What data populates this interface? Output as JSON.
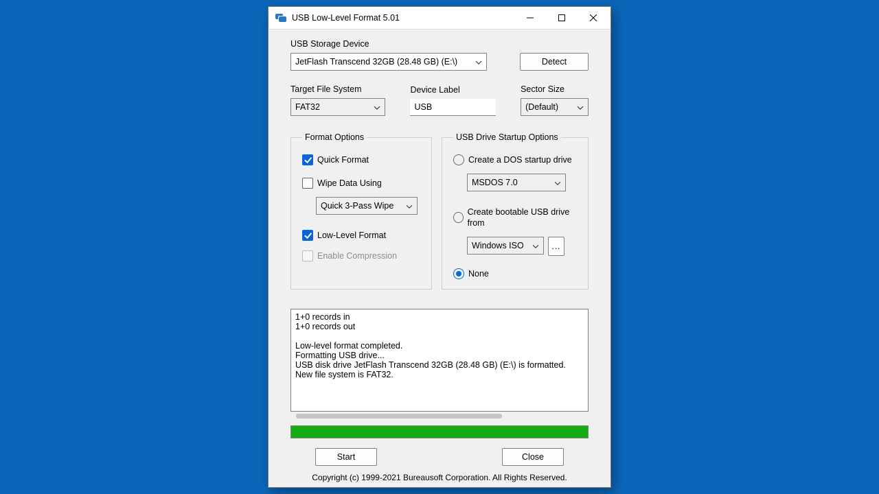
{
  "window": {
    "title": "USB Low-Level Format 5.01"
  },
  "device": {
    "label": "USB Storage Device",
    "selected": "JetFlash Transcend 32GB (28.48 GB) (E:\\)",
    "detect_button": "Detect"
  },
  "target_fs": {
    "label": "Target File System",
    "selected": "FAT32"
  },
  "dev_label": {
    "label": "Device Label",
    "value": "USB"
  },
  "sector": {
    "label": "Sector Size",
    "selected": "(Default)"
  },
  "format_opts": {
    "legend": "Format Options",
    "quick_format": "Quick Format",
    "wipe_using": "Wipe Data Using",
    "wipe_method": "Quick 3-Pass Wipe",
    "low_level": "Low-Level Format",
    "compression": "Enable Compression"
  },
  "startup_opts": {
    "legend": "USB Drive Startup Options",
    "dos": "Create a DOS startup drive",
    "dos_version": "MSDOS 7.0",
    "bootable": "Create bootable USB drive from",
    "iso_source": "Windows ISO",
    "browse": "...",
    "none": "None"
  },
  "log_text": "1+0 records in\n1+0 records out\n\nLow-level format completed.\nFormatting USB drive...\nUSB disk drive JetFlash Transcend 32GB (28.48 GB) (E:\\) is formatted.\nNew file system is FAT32.",
  "progress": {
    "percent": 100
  },
  "buttons": {
    "start": "Start",
    "close": "Close"
  },
  "copyright": "Copyright (c) 1999-2021 Bureausoft Corporation. All Rights Reserved."
}
